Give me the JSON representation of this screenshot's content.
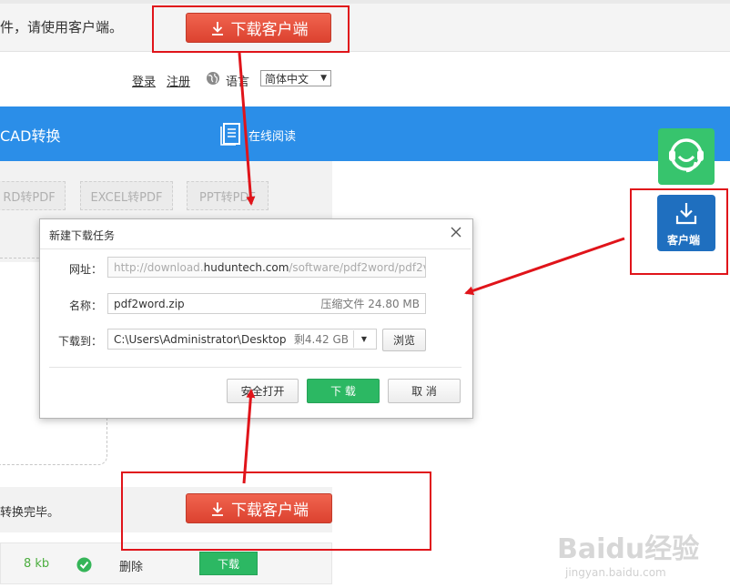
{
  "banner": {
    "text": "件，请使用客户端。",
    "download_client_label": "下载客户端"
  },
  "header": {
    "login": "登录",
    "register": "注册",
    "language_label": "语言",
    "language_value": "简体中文",
    "language_arrow": "▼"
  },
  "nav": {
    "items": [
      {
        "label": "CAD转换"
      },
      {
        "label": "在线阅读"
      }
    ]
  },
  "tabs": [
    {
      "label": "RD转PDF"
    },
    {
      "label": "EXCEL转PDF"
    },
    {
      "label": "PPT转PDF"
    }
  ],
  "side": {
    "support_icon": "headset-icon",
    "client_label": "客户端"
  },
  "dialog": {
    "title": "新建下载任务",
    "url_label": "网址：",
    "url_prefix": "http://download.",
    "url_domain": "huduntech.com",
    "url_suffix": "/software/pdf2word/pdf2v",
    "name_label": "名称：",
    "name_value": "pdf2word.zip",
    "name_info": "压缩文件 24.80 MB",
    "path_label": "下载到：",
    "path_value": "C:\\Users\\Administrator\\Desktop",
    "path_free": "剩4.42 GB",
    "browse_label": "浏览",
    "safe_open_label": "安全打开",
    "download_label": "下 载",
    "cancel_label": "取 消"
  },
  "status": {
    "done_text": "转换完毕。",
    "download_client_label": "下载客户端"
  },
  "file_row": {
    "size": "8 kb",
    "delete_label": "删除",
    "download_label": "下载"
  },
  "watermark": {
    "main": "Baidu经验",
    "sub": "jingyan.baidu.com"
  },
  "colors": {
    "nav_blue": "#2b8ee8",
    "annotation_red": "#e0141a",
    "green": "#2cb863",
    "red_button": "#e0483a"
  }
}
